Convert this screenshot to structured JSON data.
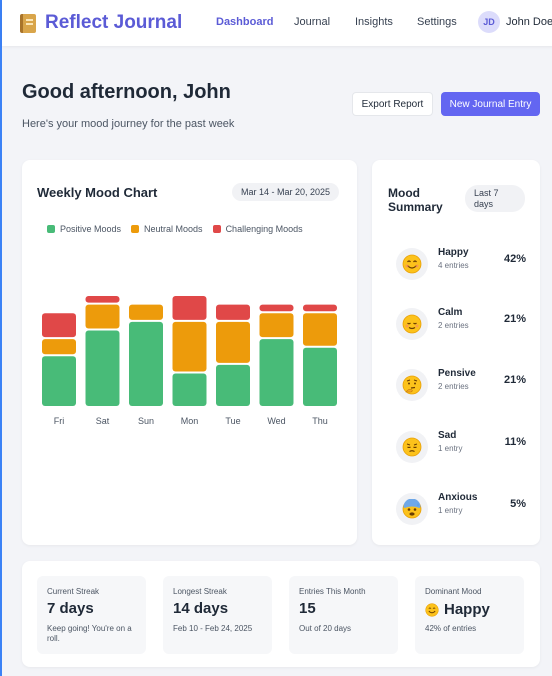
{
  "header": {
    "brand": "Reflect Journal",
    "nav": [
      "Dashboard",
      "Journal",
      "Insights",
      "Settings"
    ],
    "active_nav": "Dashboard",
    "user_initials": "JD",
    "user_name": "John Doe"
  },
  "page": {
    "greeting": "Good afternoon, John",
    "subtitle": "Here's your mood journey for the past week",
    "export_label": "Export Report",
    "new_entry_label": "New Journal Entry"
  },
  "chart_card": {
    "title": "Weekly Mood Chart",
    "date_range": "Mar 14 - Mar 20, 2025"
  },
  "chart_data": {
    "type": "bar",
    "stacked": true,
    "categories": [
      "Fri",
      "Sat",
      "Sun",
      "Mon",
      "Tue",
      "Wed",
      "Thu"
    ],
    "series": [
      {
        "name": "Positive Moods",
        "color": "#48bb78",
        "values": [
          48,
          72,
          80,
          32,
          40,
          64,
          56
        ]
      },
      {
        "name": "Neutral Moods",
        "color": "#ed9b0b",
        "values": [
          16,
          24,
          16,
          48,
          40,
          24,
          32
        ]
      },
      {
        "name": "Challenging Moods",
        "color": "#e04848",
        "values": [
          24,
          8,
          0,
          24,
          16,
          8,
          8
        ]
      }
    ],
    "ylim": [
      0,
      104
    ],
    "grid": false,
    "legend_position": "top-left"
  },
  "summary": {
    "title": "Mood Summary",
    "period": "Last 7 days",
    "moods": [
      {
        "name": "Happy",
        "count": "4 entries",
        "percent": "42%",
        "icon": "grinning-face-icon",
        "emoji": "😊"
      },
      {
        "name": "Calm",
        "count": "2 entries",
        "percent": "21%",
        "icon": "relieved-face-icon",
        "emoji": "😌"
      },
      {
        "name": "Pensive",
        "count": "2 entries",
        "percent": "21%",
        "icon": "thinking-face-icon",
        "emoji": "🤔"
      },
      {
        "name": "Sad",
        "count": "1 entry",
        "percent": "11%",
        "icon": "pensive-face-icon",
        "emoji": "😔"
      },
      {
        "name": "Anxious",
        "count": "1 entry",
        "percent": "5%",
        "icon": "anxious-face-icon",
        "emoji": "😰"
      }
    ]
  },
  "stats": {
    "current_streak": {
      "label": "Current Streak",
      "value": "7 days",
      "note": "Keep going! You're on a roll."
    },
    "longest_streak": {
      "label": "Longest Streak",
      "value": "14 days",
      "note": "Feb 10 - Feb 24, 2025"
    },
    "entries_month": {
      "label": "Entries This Month",
      "value": "15",
      "note": "Out of 20 days"
    },
    "dominant_mood": {
      "label": "Dominant Mood",
      "value": "Happy",
      "emoji": "😊",
      "note": "42% of entries"
    }
  },
  "colors": {
    "accent": "#6366f1",
    "brand": "#5b5bd6"
  }
}
